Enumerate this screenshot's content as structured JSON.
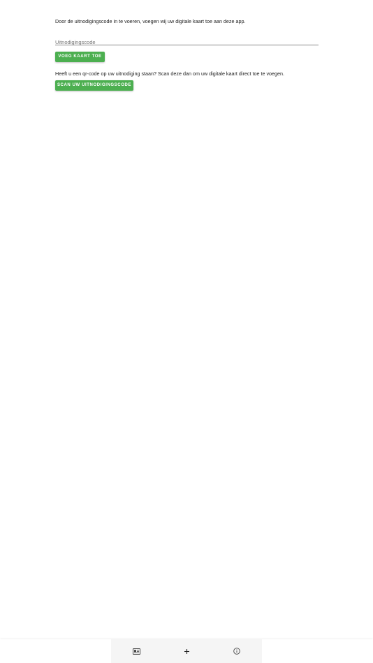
{
  "intro_text": "Door de uitnodigingscode in te voeren, voegen wij uw digitale kaart toe aan deze app.",
  "code_input": {
    "placeholder": "Uitnodigingscode",
    "value": ""
  },
  "add_button_label": "VOEG KAART TOE",
  "qr_text": "Heeft u een qr-code op uw uitnodiging staan? Scan deze dan om uw digitale kaart direct toe te voegen.",
  "scan_button_label": "SCAN UW UITNODIGINGSCODE",
  "bottom_nav": {
    "items": [
      {
        "icon": "card-icon"
      },
      {
        "icon": "plus-icon"
      },
      {
        "icon": "info-icon"
      }
    ]
  },
  "colors": {
    "accent": "#4caf50",
    "nav_background": "#f5f5f5"
  }
}
